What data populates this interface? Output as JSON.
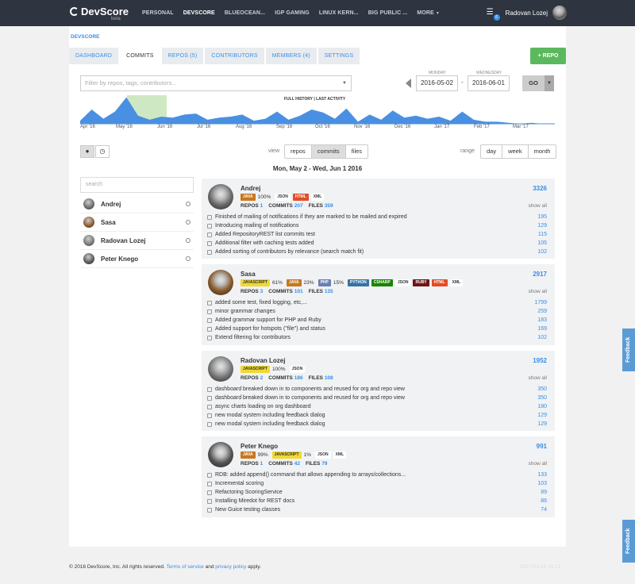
{
  "nav": {
    "logo": "DevScore",
    "logo_beta": "beta",
    "items": [
      "PERSONAL",
      "DEVSCORE",
      "BLUEOCEAN...",
      "IGP GAMING",
      "LINUX KERN...",
      "BIG PUBLIC ...",
      "MORE"
    ],
    "active": "DEVSCORE",
    "notification_count": "6",
    "user_name": "Radovan Lozej"
  },
  "breadcrumb": "DEVSCORE",
  "tabs": [
    "DASHBOARD",
    "COMMITS",
    "REPOS (5)",
    "CONTRIBUTORS",
    "MEMBERS (4)",
    "SETTINGS"
  ],
  "active_tab": "COMMITS",
  "repo_button": "+ REPO",
  "filter": {
    "placeholder": "Filter by repos, tags, contributors..."
  },
  "date_from": {
    "label": "MONDAY",
    "value": "2016-05-02"
  },
  "date_to": {
    "label": "WEDNESDAY",
    "value": "2016-06-01"
  },
  "date_separator": "-",
  "go_button": "GO",
  "history_links": {
    "full": "FULL HISTORY",
    "sep": "|",
    "last": "LAST ACTIVITY"
  },
  "timeline_months": [
    "Apr '16",
    "May '16",
    "Jun '16",
    "Jul '16",
    "Aug '16",
    "Sep '16",
    "Oct '16",
    "Nov '16",
    "Dec '16",
    "Jan '17",
    "Feb '17",
    "Mar '17"
  ],
  "chart_data": {
    "type": "area",
    "x": [
      "Apr '16",
      "",
      "May '16",
      "",
      "Jun '16",
      "",
      "Jul '16",
      "",
      "Aug '16",
      "",
      "Sep '16",
      "",
      "Oct '16",
      "",
      "Nov '16",
      "",
      "Dec '16",
      "",
      "Jan '17",
      "",
      "Feb '17",
      "",
      "Mar '17",
      "",
      ""
    ],
    "values": [
      3,
      14,
      5,
      12,
      26,
      8,
      4,
      7,
      6,
      9,
      10,
      4,
      6,
      7,
      9,
      3,
      5,
      12,
      4,
      8,
      14,
      11,
      5,
      15,
      2,
      9,
      4,
      13,
      6,
      8,
      5,
      7,
      3,
      12,
      4,
      2,
      2,
      1,
      0,
      1,
      0,
      0
    ],
    "highlight_range": [
      "2016-05-02",
      "2016-06-01"
    ]
  },
  "view": {
    "label": "view",
    "options": [
      "repos",
      "commits",
      "files"
    ],
    "active": "commits"
  },
  "range": {
    "label": "range",
    "options": [
      "day",
      "week",
      "month"
    ]
  },
  "range_title": "Mon, May 2 - Wed, Jun 1 2016",
  "search": {
    "placeholder": "search"
  },
  "contributors_list": [
    {
      "name": "Andrej",
      "color": "#6a6a6a"
    },
    {
      "name": "Sasa",
      "color": "#8a5a2a"
    },
    {
      "name": "Radovan Lozej",
      "color": "#777"
    },
    {
      "name": "Peter Knego",
      "color": "#555"
    }
  ],
  "show_all": "show all",
  "stat_labels": {
    "repos": "REPOS",
    "commits": "COMMITS",
    "files": "FILES"
  },
  "panels": [
    {
      "name": "Andrej",
      "total": "3326",
      "avatar_color": "#6a6a6a",
      "langs": [
        {
          "label": "JAVA",
          "pct": "100%",
          "bg": "#c8781d",
          "fg": "#fff"
        },
        {
          "label": "JSON",
          "pct": "",
          "bg": "#fff",
          "fg": "#333"
        },
        {
          "label": "HTML",
          "pct": "",
          "bg": "#e34c26",
          "fg": "#fff"
        },
        {
          "label": "XML",
          "pct": "",
          "bg": "#fff",
          "fg": "#333"
        }
      ],
      "repos": "1",
      "commits": "207",
      "files": "359",
      "rows": [
        {
          "msg": "Finished of mailing of notifications if they are marked to be mailed and expired",
          "val": "195"
        },
        {
          "msg": "Introducing mailing of notifications",
          "val": "129"
        },
        {
          "msg": "Added RepositoryREST list commits test",
          "val": "115"
        },
        {
          "msg": "Additional filter with caching tests added",
          "val": "105"
        },
        {
          "msg": "Added sorting of contributors by relevance (search match fit)",
          "val": "102"
        }
      ]
    },
    {
      "name": "Sasa",
      "total": "2917",
      "avatar_color": "#8a5a2a",
      "langs": [
        {
          "label": "JAVASCRIPT",
          "pct": "61%",
          "bg": "#f1d832",
          "fg": "#333"
        },
        {
          "label": "JAVA",
          "pct": "23%",
          "bg": "#c8781d",
          "fg": "#fff"
        },
        {
          "label": "PHP",
          "pct": "15%",
          "bg": "#6a7fb5",
          "fg": "#fff"
        },
        {
          "label": "PYTHON",
          "pct": "",
          "bg": "#3572a5",
          "fg": "#fff"
        },
        {
          "label": "CSHARP",
          "pct": "",
          "bg": "#178600",
          "fg": "#fff"
        },
        {
          "label": "JSON",
          "pct": "",
          "bg": "#fff",
          "fg": "#333"
        },
        {
          "label": "RUBY",
          "pct": "",
          "bg": "#701516",
          "fg": "#fff"
        },
        {
          "label": "HTML",
          "pct": "",
          "bg": "#e34c26",
          "fg": "#fff"
        },
        {
          "label": "XML",
          "pct": "",
          "bg": "#fff",
          "fg": "#333"
        }
      ],
      "repos": "3",
      "commits": "101",
      "files": "135",
      "rows": [
        {
          "msg": "added some test, fixed logging, etc,...",
          "val": "1799"
        },
        {
          "msg": "minor grammar changes",
          "val": "259"
        },
        {
          "msg": "Added grammar support for PHP and Ruby",
          "val": "183"
        },
        {
          "msg": "Added support for hotspots (\"file\") and status",
          "val": "169"
        },
        {
          "msg": "Extend filtering for contributors",
          "val": "102"
        }
      ]
    },
    {
      "name": "Radovan Lozej",
      "total": "1952",
      "avatar_color": "#777",
      "langs": [
        {
          "label": "JAVASCRIPT",
          "pct": "100%",
          "bg": "#f1d832",
          "fg": "#333"
        },
        {
          "label": "JSON",
          "pct": "",
          "bg": "#fff",
          "fg": "#333"
        }
      ],
      "repos": "2",
      "commits": "186",
      "files": "108",
      "rows": [
        {
          "msg": "dashboard breaked down in to components and reused for org and repo view",
          "val": "350"
        },
        {
          "msg": "dashboard breaked down in to components and reused for org and repo view",
          "val": "350"
        },
        {
          "msg": "async charts loading on org dashboard",
          "val": "180"
        },
        {
          "msg": "new modal system including feedback dialog",
          "val": "129"
        },
        {
          "msg": "new modal system including feedback dialog",
          "val": "129"
        }
      ]
    },
    {
      "name": "Peter Knego",
      "total": "991",
      "avatar_color": "#555",
      "langs": [
        {
          "label": "JAVA",
          "pct": "99%",
          "bg": "#c8781d",
          "fg": "#fff"
        },
        {
          "label": "JAVASCRIPT",
          "pct": "1%",
          "bg": "#f1d832",
          "fg": "#333"
        },
        {
          "label": "JSON",
          "pct": "",
          "bg": "#fff",
          "fg": "#333"
        },
        {
          "label": "XML",
          "pct": "",
          "bg": "#fff",
          "fg": "#333"
        }
      ],
      "repos": "1",
      "commits": "42",
      "files": "79",
      "rows": [
        {
          "msg": "RDB: added append() command that allows appending to arrays/collections...",
          "val": "133"
        },
        {
          "msg": "Incremental scoring",
          "val": "103"
        },
        {
          "msg": "Refactoring ScoringService",
          "val": "89"
        },
        {
          "msg": "Installing Miredot for REST docs",
          "val": "86"
        },
        {
          "msg": "New Guice testing classes",
          "val": "74"
        }
      ]
    }
  ],
  "feedback_label": "Feedback",
  "footer": {
    "text1": "© 2016 DevScore, Inc. All rights reserved.",
    "terms": "Terms of service",
    "and": "and",
    "privacy": "privacy policy",
    "apply": "apply."
  },
  "timestamp": "2017-03-29 15:12",
  "colors": {
    "accent": "#3a8ee6",
    "nav_bg": "#2e3440",
    "green": "#5cb85c",
    "chart_fill": "#4a90e2",
    "highlight": "#cfe8c4"
  }
}
